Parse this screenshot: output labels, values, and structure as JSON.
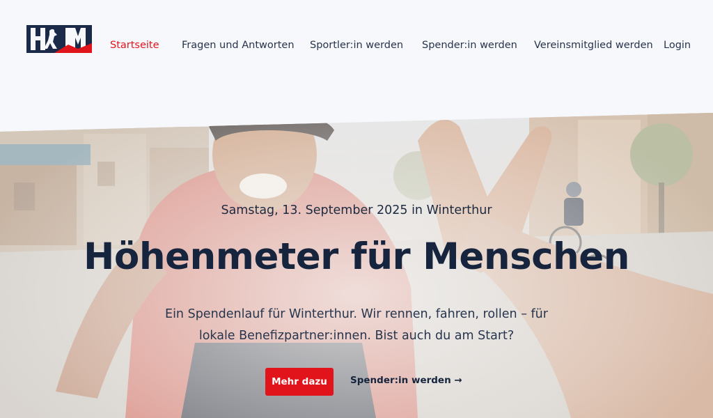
{
  "header": {
    "logo_text": "HFM",
    "nav": [
      {
        "label": "Startseite",
        "active": true
      },
      {
        "label": "Fragen und Antworten",
        "active": false
      },
      {
        "label": "Sportler:in werden",
        "active": false
      },
      {
        "label": "Spender:in werden",
        "active": false
      },
      {
        "label": "Vereinsmitglied werden",
        "active": false
      },
      {
        "label": "Login",
        "active": false
      }
    ]
  },
  "hero": {
    "image_alt": "Lachender Radfahrer gibt ein High-Five",
    "date": "Samstag, 13. September 2025 in Winterthur",
    "title": "Höhenmeter für Menschen",
    "lead": "Ein Spendenlauf für Winterthur. Wir rennen, fahren, rollen – für lokale Benefizpartner:innen. Bist auch du am Start?",
    "primary_button": "Mehr dazu",
    "secondary_link": "Spender:in werden →"
  },
  "colors": {
    "accent": "#e0151b",
    "navy": "#16243e",
    "background": "#f7f8fb"
  }
}
